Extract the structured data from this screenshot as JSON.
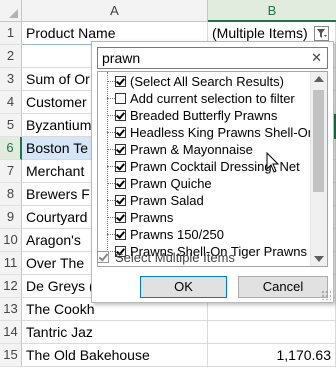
{
  "columns": {
    "a": "A",
    "b": "B"
  },
  "rows": [
    "1",
    "2",
    "3",
    "4",
    "5",
    "6",
    "7",
    "8",
    "9",
    "10",
    "11",
    "12",
    "13",
    "14",
    "15"
  ],
  "cells": {
    "a1": "Product Name",
    "b1": "(Multiple Items)",
    "a3": "Sum of Or",
    "a4": "Customer",
    "a5": "Byzantium",
    "a6": "Boston Te",
    "a7": "Merchant",
    "a8": "Brewers F",
    "a9": "Courtyard",
    "a10": "Aragon's",
    "a11": "Over The",
    "a12": "De Greys (",
    "a13": "The Cookh",
    "a14": "Tantric Jaz",
    "a15": "The Old Bakehouse",
    "b15": "1,170.63"
  },
  "filter": {
    "search_value": "prawn",
    "clear_glyph": "✕",
    "items": [
      {
        "label": "(Select All Search Results)",
        "checked": true
      },
      {
        "label": "Add current selection to filter",
        "checked": false
      },
      {
        "label": "Breaded Butterfly Prawns",
        "checked": true
      },
      {
        "label": "Headless King Prawns Shell-On",
        "checked": true
      },
      {
        "label": "Prawn & Mayonnaise",
        "checked": true
      },
      {
        "label": "Prawn Cocktail Dressing- Net",
        "checked": true
      },
      {
        "label": "Prawn Quiche",
        "checked": true
      },
      {
        "label": "Prawn Salad",
        "checked": true
      },
      {
        "label": "Prawns",
        "checked": true
      },
      {
        "label": "Prawns 150/250",
        "checked": true
      },
      {
        "label": "Prawns Shell-On Tiger Prawns",
        "checked": true
      }
    ],
    "select_multiple_label": "Select Multiple Items",
    "ok_label": "OK",
    "cancel_label": "Cancel"
  },
  "icons": {
    "filter": "filter-funnel-icon",
    "clear": "close-icon",
    "cursor": "mouse-pointer-icon"
  }
}
